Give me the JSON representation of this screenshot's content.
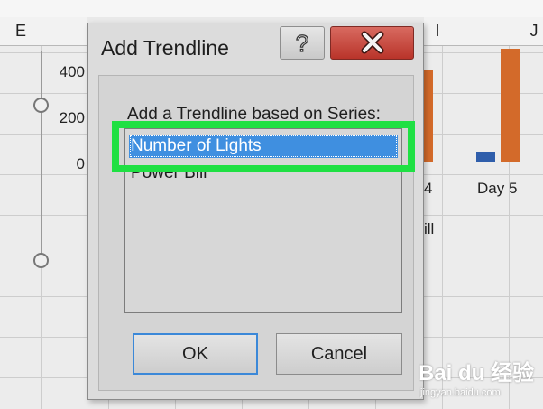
{
  "spreadsheet": {
    "column_headers": [
      "E",
      "I",
      "J"
    ],
    "chart": {
      "y_ticks": [
        "400",
        "200",
        "0"
      ],
      "x_label_day4": "4",
      "x_label_day5": "Day 5",
      "legend_fragment": "ill",
      "colors": {
        "blue_series": "#2f5eab",
        "orange_series": "#d36a2a"
      }
    }
  },
  "dialog": {
    "title": "Add Trendline",
    "help_label": "?",
    "prompt": "Add a Trendline based on Series:",
    "series_options": [
      "Number of Lights",
      "Power Bill"
    ],
    "selected_index": 0,
    "ok_label": "OK",
    "cancel_label": "Cancel"
  },
  "watermark": {
    "logo_text": "Bai du 经验",
    "url_text": "jingyan.baidu.com"
  },
  "highlight_color": "#1fe043"
}
